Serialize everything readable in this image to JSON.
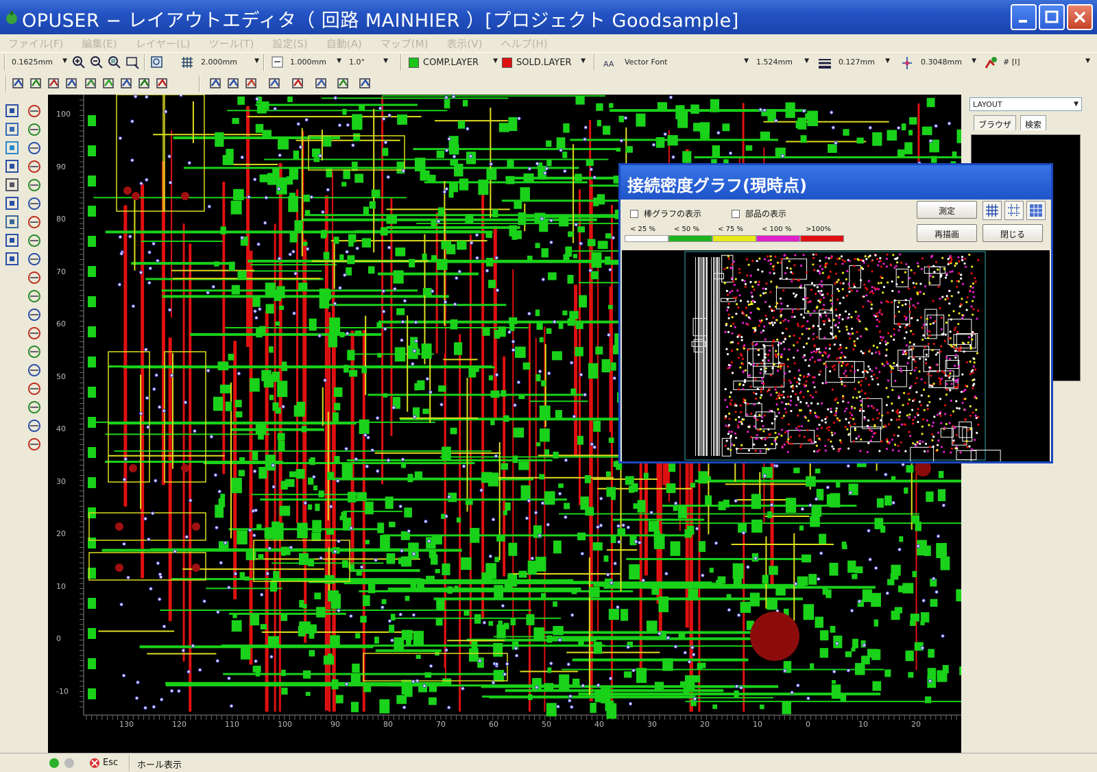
{
  "window": {
    "title": "OPUSER − レイアウトエディタ（ 回路 MAINHIER ）[プロジェクト Goodsample]"
  },
  "menu": {
    "items": [
      "ファイル(F)",
      "編集(E)",
      "レイヤー(L)",
      "ツール(T)",
      "設定(S)",
      "自動(A)",
      "マップ(M)",
      "表示(V)",
      "ヘルプ(H)"
    ]
  },
  "toolbar": {
    "grid_step": "0.1625mm",
    "snap": "2.000mm",
    "line_step": "1.000mm",
    "angle": "1.0°",
    "comp_layer": "COMP.LAYER",
    "sold_layer": "SOLD.LAYER",
    "font": "Vector Font",
    "text_size": "1.524mm",
    "line_width": "0.127mm",
    "via_size": "0.3048mm",
    "net": "# [I]",
    "colors": {
      "comp": "#19c619",
      "sold": "#e01010"
    }
  },
  "canvas": {
    "y_ticks": [
      "100",
      "90",
      "80",
      "70",
      "60",
      "50",
      "40",
      "30",
      "20",
      "10",
      "0",
      "-10"
    ],
    "x_ticks": [
      "130",
      "120",
      "110",
      "100",
      "90",
      "80",
      "70",
      "60",
      "50",
      "40",
      "30",
      "20",
      "10",
      "0",
      "10",
      "20"
    ]
  },
  "right_panel": {
    "select_value": "LAYOUT",
    "tabs": [
      "ブラウザ",
      "検索"
    ]
  },
  "status": {
    "esc": "Esc",
    "message": "ホール表示"
  },
  "dialog": {
    "title": "接続密度グラフ(現時点)",
    "check_bar": "棒グラフの表示",
    "check_parts": "部品の表示",
    "legend": [
      "< 25 %",
      "< 50 %",
      "< 75 %",
      "< 100 %",
      ">100%"
    ],
    "legend_colors": [
      "#ffffff",
      "#1db31d",
      "#e8e81a",
      "#e020c8",
      "#e01010"
    ],
    "btn_measure": "測定",
    "btn_redraw": "再描画",
    "btn_close": "閉じる"
  }
}
